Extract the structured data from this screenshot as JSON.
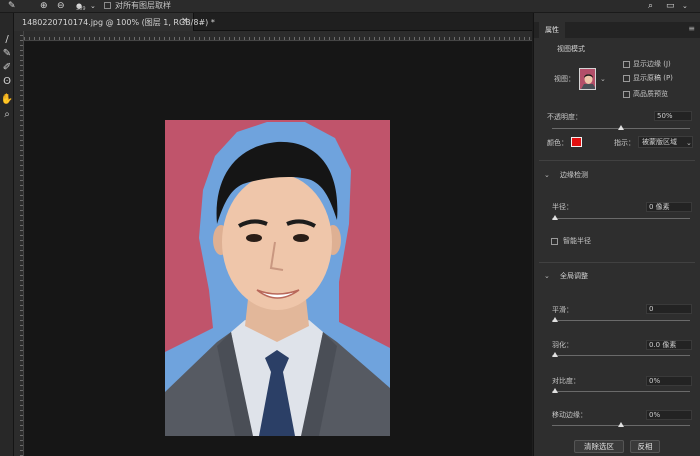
{
  "options_bar": {
    "sample_all_layers_label": "对所有图层取样",
    "brush_size": "309"
  },
  "document": {
    "tab_title": "1480220710174.jpg @ 100% (图层 1, RGB/8#) *",
    "close_glyph": "×"
  },
  "properties_panel": {
    "tab_label": "属性",
    "view_mode_heading": "视图模式",
    "view_label": "视图：",
    "show_edge_label": "显示边缘 (J)",
    "show_original_label": "显示原稿 (P)",
    "hq_preview_label": "高品质预览",
    "opacity_label": "不透明度：",
    "opacity_value": "50%",
    "opacity_fraction": 0.5,
    "color_label": "颜色：",
    "color_value": "#e11010",
    "indicate_label": "指示：",
    "indicate_value": "被蒙版区域",
    "edge_detection_heading": "边缘检测",
    "radius_label": "半径：",
    "radius_value": "0 像素",
    "smart_radius_label": "智能半径",
    "global_refine_heading": "全局调整",
    "smooth_label": "平滑：",
    "smooth_value": "0",
    "feather_label": "羽化：",
    "feather_value": "0.0 像素",
    "contrast_label": "对比度：",
    "contrast_value": "0%",
    "shift_edge_label": "移动边缘：",
    "shift_edge_value": "0%",
    "clear_selection_button": "清除选区",
    "invert_button": "反相"
  },
  "icons": {
    "toolbar": [
      "brush-icon",
      "quick-selection-icon",
      "refine-edge-brush-icon",
      "lasso-icon",
      "hand-icon",
      "zoom-icon"
    ]
  }
}
